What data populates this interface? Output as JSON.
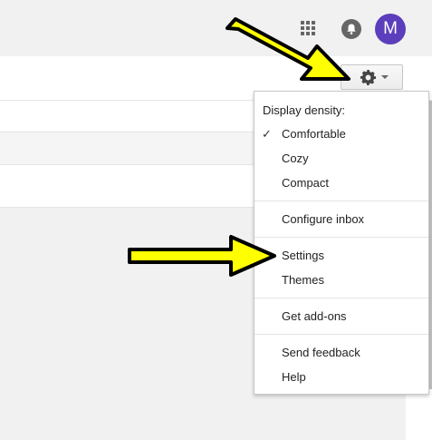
{
  "header": {
    "avatar_letter": "M"
  },
  "menu": {
    "header_label": "Display density:",
    "items": [
      {
        "label": "Comfortable",
        "checked": true
      },
      {
        "label": "Cozy"
      },
      {
        "label": "Compact"
      },
      {
        "label": "Configure inbox"
      },
      {
        "label": "Settings"
      },
      {
        "label": "Themes"
      },
      {
        "label": "Get add-ons"
      },
      {
        "label": "Send feedback"
      },
      {
        "label": "Help"
      }
    ]
  },
  "icons": {
    "apps": "apps-grid-icon",
    "notifications": "bell-icon",
    "settings": "gear-icon",
    "dropdown": "caret-down-icon",
    "checked": "check-icon"
  },
  "colors": {
    "avatar": "#5b3ebc",
    "annotation_arrow": "#ffff00"
  }
}
